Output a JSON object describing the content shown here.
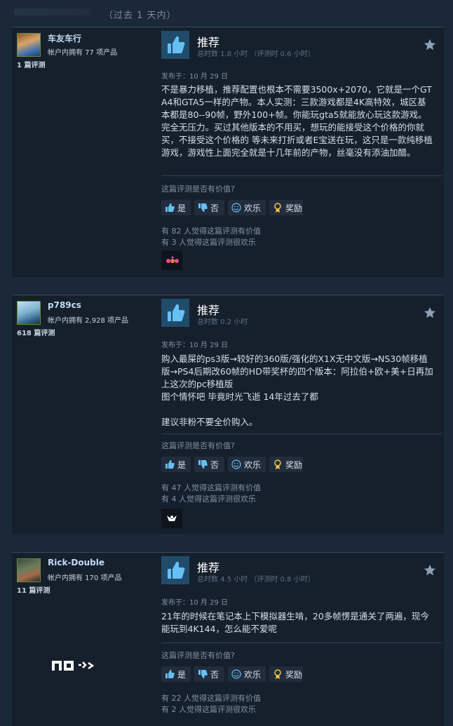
{
  "filter": {
    "range_label": "（过去 1 天内）"
  },
  "common": {
    "helpful_question": "这篇评测是否有价值?",
    "yes_label": "是",
    "no_label": "否",
    "funny_label": "欢乐",
    "award_label": "奖励",
    "recommend_label": "推荐"
  },
  "reviews": [
    {
      "username": "车友车行",
      "products_owned": "帐户内拥有 77 项产品",
      "reviews_count": "1 篇评测",
      "hours": "总时数 1.8 小时 （评测时 0.6 小时）",
      "posted": "发布于：10 月 29 日",
      "text": "不是暴力移植，推荐配置也根本不需要3500x+2070，它就是一个GTA4和GTA5一样的产物。本人实测：三款游戏都是4K高特效，城区基本都是80--90帧，野外100+帧。你能玩gta5就能放心玩这款游戏。完全无压力。买过其他版本的不用买，想玩的能接受这个价格的你就买，不接受这个价格的 等未来打折或者E宝送在玩，这只是一款纯移植游戏，游戏性上面完全就是十几年前的产物，丝毫没有添油加醋。",
      "helpful_stat": "有 82 人觉得这篇评测有价值",
      "funny_stat": "有 3 人觉得这篇评测很欢乐"
    },
    {
      "username": "p789cs",
      "products_owned": "帐户内拥有 2,928 项产品",
      "reviews_count": "618 篇评测",
      "hours": "总时数 0.2 小时",
      "posted": "发布于：10 月 29 日",
      "text": "购入最屎的ps3版→较好的360版/强化的X1X无中文版→NS30帧移植版→PS4后期改60帧的HD带奖杯的四个版本：阿拉伯+欧+美+日再加上这次的pc移植版\n图个情怀吧 毕竟时光飞逝 14年过去了都\n\n建议非粉不要全价购入。",
      "helpful_stat": "有 47 人觉得这篇评测有价值",
      "funny_stat": "有 4 人觉得这篇评测很欢乐"
    },
    {
      "username": "Rick-Double",
      "products_owned": "帐户内拥有 170 项产品",
      "reviews_count": "11 篇评测",
      "hours": "总时数 4.5 小时 （评测时 0.8 小时）",
      "posted": "发布于：10 月 29 日",
      "text": "21年的时候在笔记本上下模拟器生啃，20多帧愣是通关了两遍，现今能玩到4K144，怎么能不爱呢",
      "helpful_stat": "有 22 人觉得这篇评测有价值",
      "funny_stat": "有 2 人觉得这篇评测很欢乐"
    }
  ],
  "colors": {
    "background": "#1b2838",
    "card": "#16202d",
    "accent_blue": "#66c0f4",
    "username": "#c1dbf4"
  }
}
